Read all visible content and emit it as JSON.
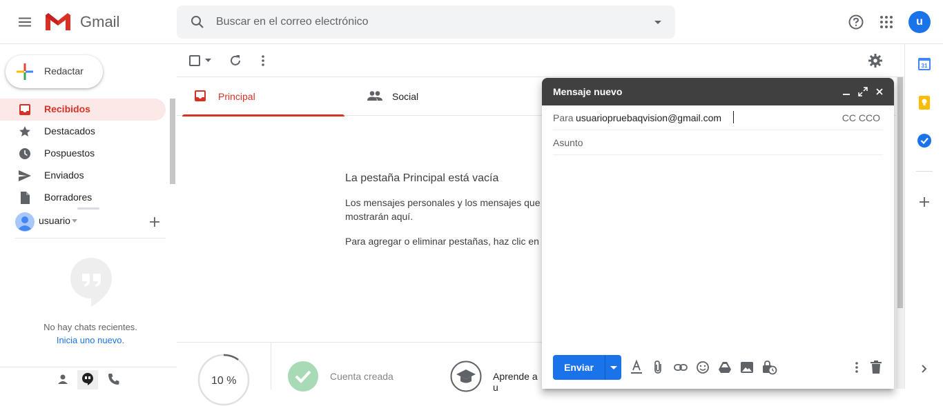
{
  "header": {
    "app_name": "Gmail",
    "search_placeholder": "Buscar en el correo electrónico",
    "avatar_letter": "u"
  },
  "colors": {
    "accent": "#1a73e8",
    "inbox_red": "#d93025",
    "compose_header": "#404040"
  },
  "nav": {
    "compose_label": "Redactar",
    "items": [
      {
        "label": "Recibidos",
        "icon": "inbox-icon",
        "active": true
      },
      {
        "label": "Destacados",
        "icon": "star-icon"
      },
      {
        "label": "Pospuestos",
        "icon": "clock-icon"
      },
      {
        "label": "Enviados",
        "icon": "send-icon"
      },
      {
        "label": "Borradores",
        "icon": "draft-icon"
      }
    ]
  },
  "hangouts": {
    "user_name": "usuario",
    "no_chats": "No hay chats recientes.",
    "start_new": "Inicia uno nuevo."
  },
  "tabs": [
    {
      "label": "Principal",
      "icon": "inbox-icon",
      "active": true
    },
    {
      "label": "Social",
      "icon": "people-icon"
    }
  ],
  "empty_state": {
    "title": "La pestaña Principal está vacía",
    "line1": "Los mensajes personales y los mensajes que",
    "line2": "mostrarán aquí.",
    "line3": "Para agregar o eliminar pestañas, haz clic en C"
  },
  "setup": {
    "progress_label": "10 %",
    "progress_value": 0.1,
    "account_created": "Cuenta creada",
    "learn": "Aprende a u"
  },
  "compose_window": {
    "title": "Mensaje nuevo",
    "to_label": "Para",
    "to_value": "usuariopruebaqvision@gmail.com",
    "cc_bcc": "CC CCO",
    "subject_placeholder": "Asunto",
    "send_label": "Enviar"
  }
}
